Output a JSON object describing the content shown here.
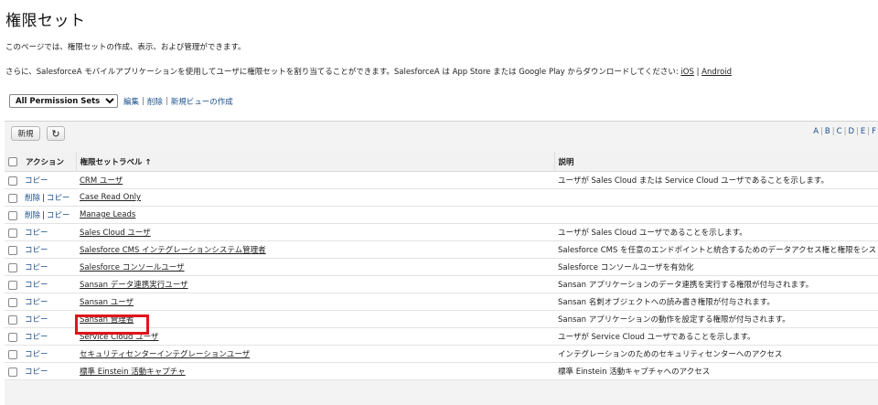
{
  "page": {
    "title": "権限セット",
    "description": "このページでは、権限セットの作成、表示、および管理ができます。",
    "mobile_text": "さらに、SalesforceA モバイルアプリケーションを使用してユーザに権限セットを割り当てることができます。SalesforceA は App Store または Google Play からダウンロードしてください:",
    "ios_link": "iOS",
    "link_sep": "|",
    "android_link": "Android"
  },
  "view": {
    "selected": "All Permission Sets",
    "edit": "編集",
    "delete": "削除",
    "new_view": "新規ビューの作成",
    "sep": "|"
  },
  "toolbar": {
    "new_button": "新規",
    "refresh_icon": "refresh-icon"
  },
  "alphabet": [
    "A",
    "B",
    "C",
    "D",
    "E",
    "F"
  ],
  "table": {
    "headers": {
      "action": "アクション",
      "label": "権限セットラベル ↑",
      "description": "説明"
    },
    "rows": [
      {
        "actions": [
          "コピー"
        ],
        "label": "CRM ユーザ",
        "description": "ユーザが Sales Cloud または Service Cloud ユーザであることを示します。"
      },
      {
        "actions": [
          "削除",
          "コピー"
        ],
        "label": "Case Read Only",
        "description": ""
      },
      {
        "actions": [
          "削除",
          "コピー"
        ],
        "label": "Manage Leads",
        "description": ""
      },
      {
        "actions": [
          "コピー"
        ],
        "label": "Sales Cloud ユーザ",
        "description": "ユーザが Sales Cloud ユーザであることを示します。"
      },
      {
        "actions": [
          "コピー"
        ],
        "label": "Salesforce CMS インテグレーションシステム管理者",
        "description": "Salesforce CMS を任意のエンドポイントと統合するためのデータアクセス権と権限をシス"
      },
      {
        "actions": [
          "コピー"
        ],
        "label": "Salesforce コンソールユーザ",
        "description": "Salesforce コンソールユーザを有効化"
      },
      {
        "actions": [
          "コピー"
        ],
        "label": "Sansan データ連携実行ユーザ",
        "description": "Sansan アプリケーションのデータ連携を実行する権限が付与されます。"
      },
      {
        "actions": [
          "コピー"
        ],
        "label": "Sansan ユーザ",
        "description": "Sansan 名刺オブジェクトへの読み書き権限が付与されます。"
      },
      {
        "actions": [
          "コピー"
        ],
        "label": "Sansan 管理者",
        "description": "Sansan アプリケーションの動作を設定する権限が付与されます。"
      },
      {
        "actions": [
          "コピー"
        ],
        "label": "Service Cloud ユーザ",
        "description": "ユーザが Service Cloud ユーザであることを示します。"
      },
      {
        "actions": [
          "コピー"
        ],
        "label": "セキュリティセンターインテグレーションユーザ",
        "description": "インテグレーションのためのセキュリティセンターへのアクセス"
      },
      {
        "actions": [
          "コピー"
        ],
        "label": "標準 Einstein 活動キャプチャ",
        "description": "標準 Einstein 活動キャプチャへのアクセス"
      }
    ]
  },
  "colors": {
    "link": "#1a4f8a",
    "highlight": "#e0151b",
    "header_bg": "#f2f2f2"
  }
}
